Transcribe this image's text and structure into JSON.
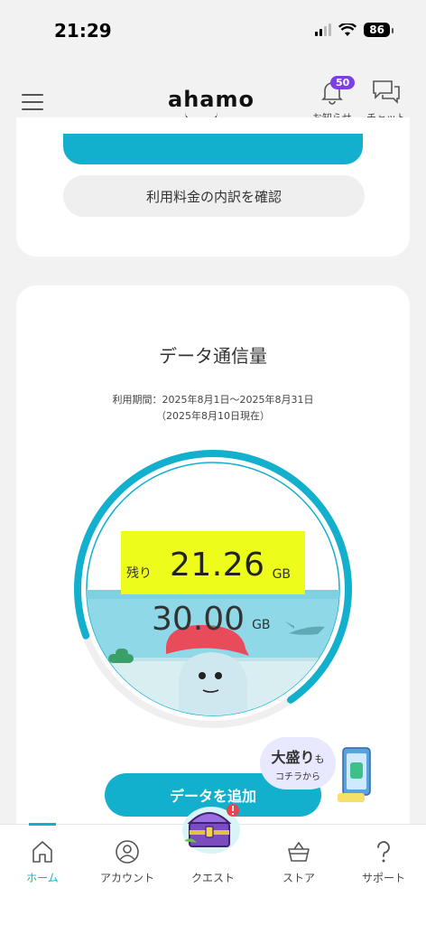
{
  "status_bar": {
    "time": "21:29",
    "battery": "86"
  },
  "header": {
    "logo": "ahamo",
    "notifications": {
      "label": "お知らせ",
      "count": "50"
    },
    "chat": {
      "label": "チャット"
    }
  },
  "billing_card": {
    "breakdown_button": "利用料金の内訳を確認"
  },
  "data_card": {
    "title": "データ通信量",
    "period": "利用期間：2025年8月1日〜2025年8月31日",
    "as_of": "（2025年8月10日現在）",
    "remaining_label": "残り",
    "remaining_value": "21.26",
    "remaining_unit": "GB",
    "total_value": "30.00",
    "total_unit": "GB",
    "remaining_fraction": 0.7087,
    "add_data_button": "データを追加",
    "omori_main": "大盛り",
    "omori_mo": "も",
    "omori_sub": "コチラから"
  },
  "colors": {
    "accent": "#12b0cc",
    "highlight": "#eefc1c",
    "badge": "#7b3fe4"
  },
  "bottom_nav": {
    "items": [
      {
        "label": "ホーム",
        "icon": "home-icon"
      },
      {
        "label": "アカウント",
        "icon": "account-icon"
      },
      {
        "label": "クエスト",
        "icon": "treasure-chest-icon"
      },
      {
        "label": "ストア",
        "icon": "basket-icon"
      },
      {
        "label": "サポート",
        "icon": "question-icon"
      }
    ]
  }
}
